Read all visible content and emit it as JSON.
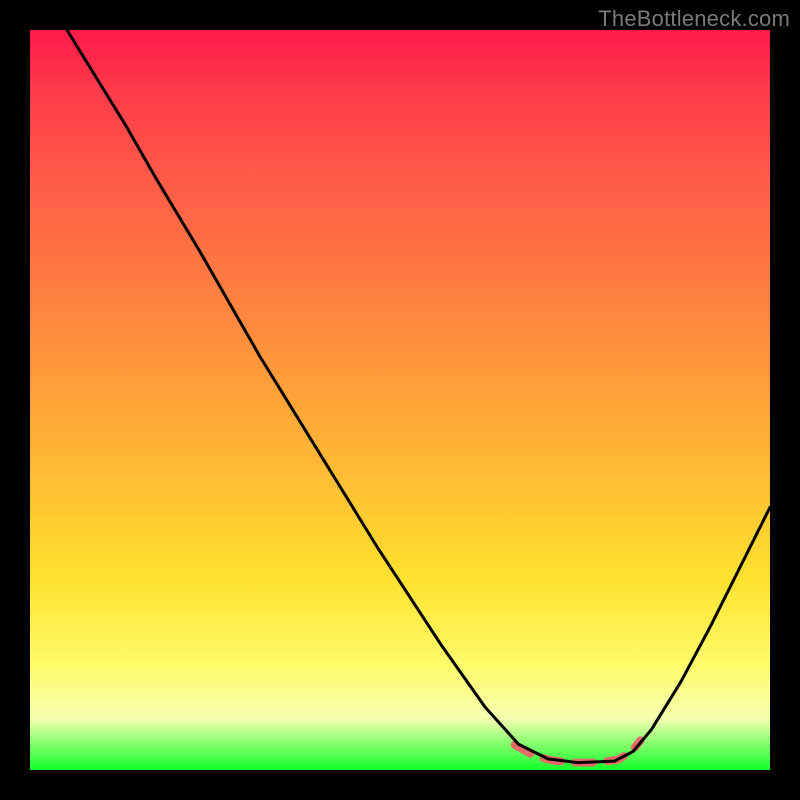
{
  "watermark": "TheBottleneck.com",
  "chart_data": {
    "type": "line",
    "title": "",
    "xlabel": "",
    "ylabel": "",
    "xlim": [
      0,
      1
    ],
    "ylim": [
      0,
      1
    ],
    "gradient_stops": [
      {
        "pos": 0.0,
        "color": "#ff1a4a"
      },
      {
        "pos": 0.08,
        "color": "#ff3a4a"
      },
      {
        "pos": 0.2,
        "color": "#ff5a47"
      },
      {
        "pos": 0.4,
        "color": "#ff8a3e"
      },
      {
        "pos": 0.58,
        "color": "#ffb734"
      },
      {
        "pos": 0.74,
        "color": "#ffe12e"
      },
      {
        "pos": 0.86,
        "color": "#fffb6a"
      },
      {
        "pos": 0.93,
        "color": "#f6ffb0"
      },
      {
        "pos": 1.0,
        "color": "#12ff2a"
      }
    ],
    "series": [
      {
        "name": "black-curve",
        "type": "line",
        "color": "#000000",
        "width": 3,
        "points": [
          {
            "x": 0.05,
            "y": 1.0
          },
          {
            "x": 0.09,
            "y": 0.935
          },
          {
            "x": 0.13,
            "y": 0.87
          },
          {
            "x": 0.17,
            "y": 0.8
          },
          {
            "x": 0.23,
            "y": 0.7
          },
          {
            "x": 0.31,
            "y": 0.56
          },
          {
            "x": 0.39,
            "y": 0.43
          },
          {
            "x": 0.47,
            "y": 0.3
          },
          {
            "x": 0.555,
            "y": 0.17
          },
          {
            "x": 0.615,
            "y": 0.085
          },
          {
            "x": 0.66,
            "y": 0.035
          },
          {
            "x": 0.7,
            "y": 0.015
          },
          {
            "x": 0.74,
            "y": 0.01
          },
          {
            "x": 0.79,
            "y": 0.012
          },
          {
            "x": 0.815,
            "y": 0.025
          },
          {
            "x": 0.84,
            "y": 0.055
          },
          {
            "x": 0.88,
            "y": 0.12
          },
          {
            "x": 0.92,
            "y": 0.195
          },
          {
            "x": 0.96,
            "y": 0.275
          },
          {
            "x": 1.0,
            "y": 0.355
          }
        ]
      },
      {
        "name": "pink-salmon-accent",
        "type": "line",
        "color": "#e46a6a",
        "width": 8,
        "dash": [
          18,
          14
        ],
        "points": [
          {
            "x": 0.655,
            "y": 0.034
          },
          {
            "x": 0.68,
            "y": 0.02
          },
          {
            "x": 0.705,
            "y": 0.013
          },
          {
            "x": 0.735,
            "y": 0.01
          },
          {
            "x": 0.765,
            "y": 0.01
          },
          {
            "x": 0.795,
            "y": 0.014
          },
          {
            "x": 0.813,
            "y": 0.025
          },
          {
            "x": 0.825,
            "y": 0.04
          }
        ]
      }
    ]
  }
}
